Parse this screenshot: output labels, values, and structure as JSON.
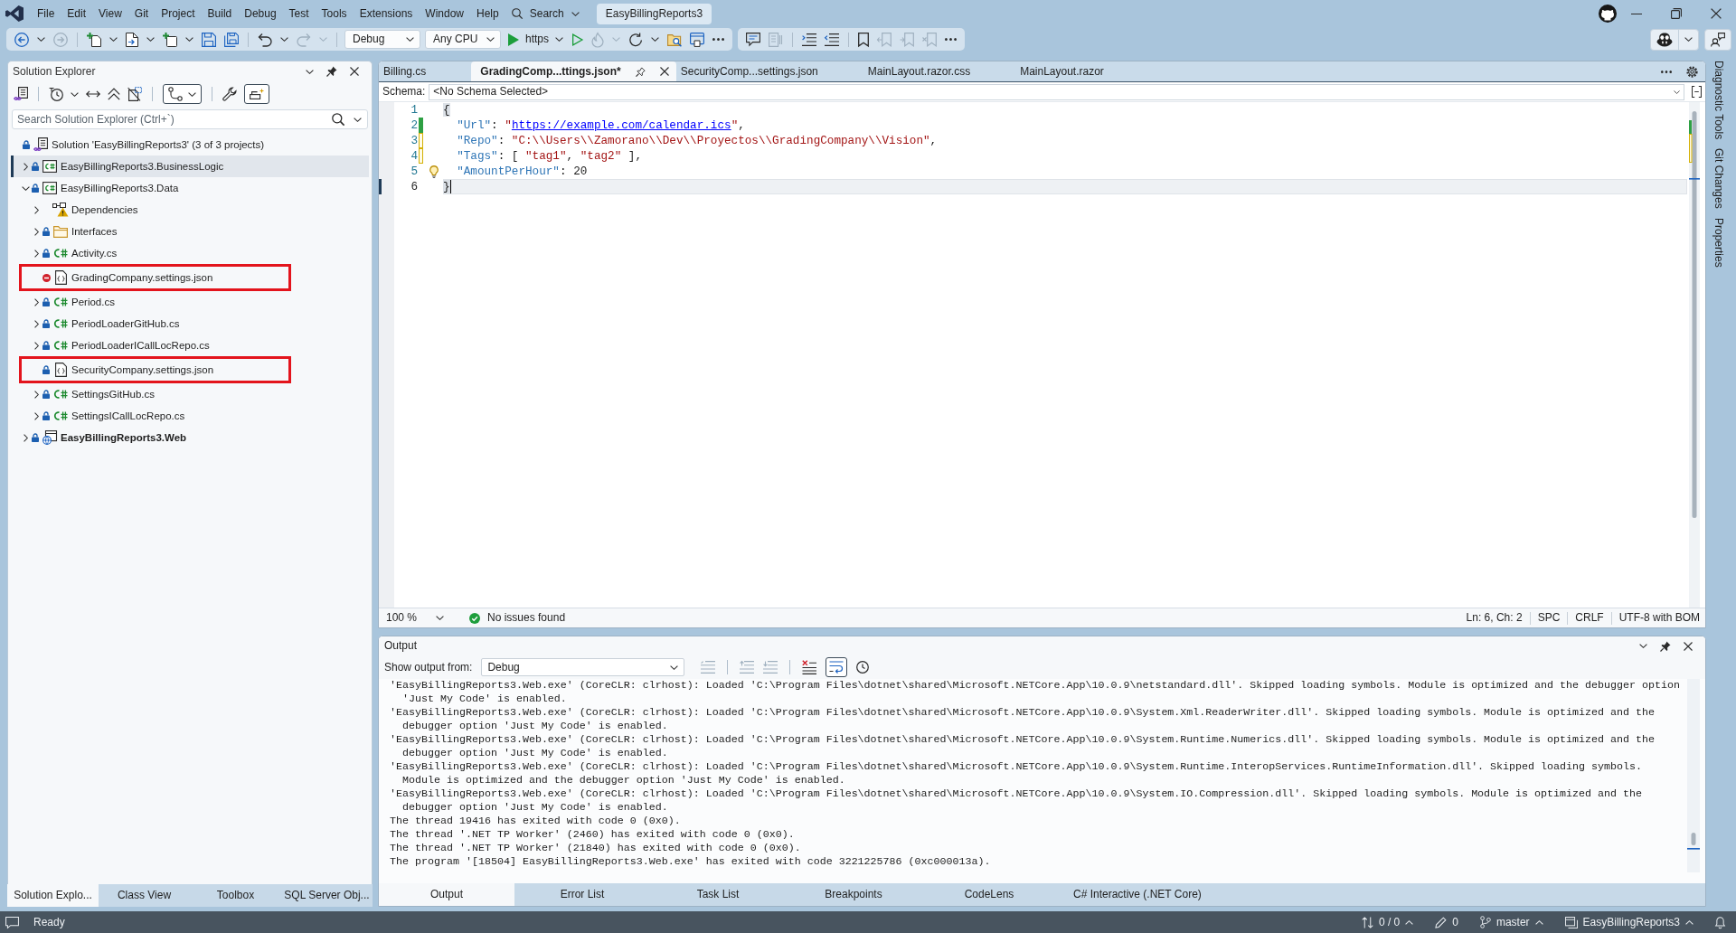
{
  "window": {
    "title": "EasyBillingReports3"
  },
  "menu": [
    "File",
    "Edit",
    "View",
    "Git",
    "Project",
    "Build",
    "Debug",
    "Test",
    "Tools",
    "Extensions",
    "Window",
    "Help"
  ],
  "search": {
    "label": "Search"
  },
  "toolbar": {
    "configuration": "Debug",
    "platform": "Any CPU",
    "launch_profile": "https"
  },
  "solution_explorer": {
    "title": "Solution Explorer",
    "search": {
      "placeholder": "Search Solution Explorer (Ctrl+`)"
    },
    "tree": [
      {
        "label": "Solution 'EasyBillingReports3' (3 of 3 projects)",
        "kind": "solution",
        "locked": true,
        "ignored": false,
        "selected": false,
        "highlighted": false,
        "children": [
          {
            "label": "EasyBillingReports3.BusinessLogic",
            "kind": "csproj",
            "locked": true,
            "ignored": false,
            "expanded": false,
            "startup": false,
            "selected": true,
            "highlighted": false
          },
          {
            "label": "EasyBillingReports3.Data",
            "kind": "csproj",
            "locked": true,
            "ignored": false,
            "expanded": true,
            "startup": false,
            "selected": false,
            "highlighted": false,
            "children": [
              {
                "label": "Dependencies",
                "kind": "dependencies",
                "locked": false,
                "ignored": false,
                "expanded": false,
                "selected": false,
                "highlighted": false
              },
              {
                "label": "Interfaces",
                "kind": "folder",
                "locked": true,
                "ignored": false,
                "expanded": false,
                "selected": false,
                "highlighted": false
              },
              {
                "label": "Activity.cs",
                "kind": "cs",
                "locked": true,
                "ignored": false,
                "expanded": false,
                "selected": false,
                "highlighted": false
              },
              {
                "label": "GradingCompany.settings.json",
                "kind": "json",
                "locked": false,
                "ignored": true,
                "selected": false,
                "highlighted": true
              },
              {
                "label": "Period.cs",
                "kind": "cs",
                "locked": true,
                "ignored": false,
                "expanded": false,
                "selected": false,
                "highlighted": false
              },
              {
                "label": "PeriodLoaderGitHub.cs",
                "kind": "cs",
                "locked": true,
                "ignored": false,
                "expanded": false,
                "selected": false,
                "highlighted": false
              },
              {
                "label": "PeriodLoaderICallLocRepo.cs",
                "kind": "cs",
                "locked": true,
                "ignored": false,
                "expanded": false,
                "selected": false,
                "highlighted": false
              },
              {
                "label": "SecurityCompany.settings.json",
                "kind": "json",
                "locked": true,
                "ignored": false,
                "selected": false,
                "highlighted": true
              },
              {
                "label": "SettingsGitHub.cs",
                "kind": "cs",
                "locked": true,
                "ignored": false,
                "expanded": false,
                "selected": false,
                "highlighted": false
              },
              {
                "label": "SettingsICallLocRepo.cs",
                "kind": "cs",
                "locked": true,
                "ignored": false,
                "expanded": false,
                "selected": false,
                "highlighted": false
              }
            ]
          },
          {
            "label": "EasyBillingReports3.Web",
            "kind": "webproj",
            "locked": true,
            "ignored": false,
            "expanded": false,
            "startup": true,
            "selected": false,
            "highlighted": false
          }
        ]
      }
    ],
    "tabs": [
      {
        "label": "Solution Explo...",
        "selected": true
      },
      {
        "label": "Class View",
        "selected": false
      },
      {
        "label": "Toolbox",
        "selected": false
      },
      {
        "label": "SQL Server Obj...",
        "selected": false
      }
    ]
  },
  "editor": {
    "tabs": [
      {
        "label": "Billing.cs",
        "selected": false
      },
      {
        "label": "GradingComp...ttings.json*",
        "selected": true
      },
      {
        "label": "SecurityComp...settings.json",
        "selected": false
      },
      {
        "label": "MainLayout.razor.css",
        "selected": false
      },
      {
        "label": "MainLayout.razor",
        "selected": false
      }
    ],
    "schema": {
      "label": "Schema:",
      "value": "<No Schema Selected>"
    },
    "lines": [
      {
        "number": "1",
        "saved_change": false,
        "unsaved_change": false,
        "current": false,
        "lightbulb": false,
        "tokens": [
          {
            "kind": "brace",
            "text": "{",
            "matched": true
          }
        ]
      },
      {
        "number": "2",
        "saved_change": true,
        "unsaved_change": false,
        "current": false,
        "lightbulb": false,
        "tokens": [
          {
            "kind": "key",
            "text": "  \"Url\""
          },
          {
            "kind": "punct",
            "text": ": "
          },
          {
            "kind": "string",
            "text": "\""
          },
          {
            "kind": "link",
            "text": "https://example.com/calendar.ics"
          },
          {
            "kind": "string",
            "text": "\""
          },
          {
            "kind": "punct",
            "text": ","
          }
        ]
      },
      {
        "number": "3",
        "saved_change": false,
        "unsaved_change": true,
        "current": false,
        "lightbulb": false,
        "tokens": [
          {
            "kind": "key",
            "text": "  \"Repo\""
          },
          {
            "kind": "punct",
            "text": ": "
          },
          {
            "kind": "string",
            "text": "\"C:\\\\Users\\\\Zamorano\\\\Dev\\\\Proyectos\\\\GradingCompany\\\\Vision\""
          },
          {
            "kind": "punct",
            "text": ","
          }
        ]
      },
      {
        "number": "4",
        "saved_change": false,
        "unsaved_change": true,
        "current": false,
        "lightbulb": false,
        "tokens": [
          {
            "kind": "key",
            "text": "  \"Tags\""
          },
          {
            "kind": "punct",
            "text": ": [ "
          },
          {
            "kind": "string",
            "text": "\"tag1\""
          },
          {
            "kind": "punct",
            "text": ", "
          },
          {
            "kind": "string",
            "text": "\"tag2\""
          },
          {
            "kind": "punct",
            "text": " ],"
          }
        ]
      },
      {
        "number": "5",
        "saved_change": false,
        "unsaved_change": false,
        "current": false,
        "lightbulb": true,
        "tokens": [
          {
            "kind": "key",
            "text": "  \"AmountPerHour\""
          },
          {
            "kind": "punct",
            "text": ": "
          },
          {
            "kind": "number",
            "text": "20"
          }
        ]
      },
      {
        "number": "6",
        "saved_change": false,
        "unsaved_change": false,
        "current": true,
        "lightbulb": false,
        "tokens": [
          {
            "kind": "brace",
            "text": "}",
            "matched": true
          }
        ]
      }
    ],
    "zoom": "100 %",
    "issues": "No issues found",
    "position": "Ln: 6, Ch: 2",
    "indentation": "SPC",
    "line_endings": "CRLF",
    "encoding": "UTF-8 with BOM"
  },
  "output": {
    "title": "Output",
    "source_label": "Show output from:",
    "source": "Debug",
    "word_wrap": true,
    "lines": [
      "'EasyBillingReports3.Web.exe' (CoreCLR: clrhost): Loaded 'C:\\Program Files\\dotnet\\shared\\Microsoft.NETCore.App\\10.0.9\\netstandard.dll'. Skipped loading symbols. Module is optimized and the debugger option 'Just My Code' is enabled.",
      "'EasyBillingReports3.Web.exe' (CoreCLR: clrhost): Loaded 'C:\\Program Files\\dotnet\\shared\\Microsoft.NETCore.App\\10.0.9\\System.Xml.ReaderWriter.dll'. Skipped loading symbols. Module is optimized and the debugger option 'Just My Code' is enabled.",
      "'EasyBillingReports3.Web.exe' (CoreCLR: clrhost): Loaded 'C:\\Program Files\\dotnet\\shared\\Microsoft.NETCore.App\\10.0.9\\System.Runtime.Numerics.dll'. Skipped loading symbols. Module is optimized and the debugger option 'Just My Code' is enabled.",
      "'EasyBillingReports3.Web.exe' (CoreCLR: clrhost): Loaded 'C:\\Program Files\\dotnet\\shared\\Microsoft.NETCore.App\\10.0.9\\System.Runtime.InteropServices.RuntimeInformation.dll'. Skipped loading symbols. Module is optimized and the debugger option 'Just My Code' is enabled.",
      "'EasyBillingReports3.Web.exe' (CoreCLR: clrhost): Loaded 'C:\\Program Files\\dotnet\\shared\\Microsoft.NETCore.App\\10.0.9\\System.IO.Compression.dll'. Skipped loading symbols. Module is optimized and the debugger option 'Just My Code' is enabled.",
      "The thread 19416 has exited with code 0 (0x0).",
      "The thread '.NET TP Worker' (2460) has exited with code 0 (0x0).",
      "The thread '.NET TP Worker' (21840) has exited with code 0 (0x0).",
      "The program '[18504] EasyBillingReports3.Web.exe' has exited with code 3221225786 (0xc000013a)."
    ],
    "tabs": [
      {
        "label": "Output",
        "selected": true
      },
      {
        "label": "Error List",
        "selected": false
      },
      {
        "label": "Task List",
        "selected": false
      },
      {
        "label": "Breakpoints",
        "selected": false
      },
      {
        "label": "CodeLens",
        "selected": false
      },
      {
        "label": "C# Interactive (.NET Core)",
        "selected": false
      }
    ]
  },
  "side_tabs": [
    "Diagnostic Tools",
    "Git Changes",
    "Properties"
  ],
  "status_bar": {
    "message": "Ready",
    "sync": "0 / 0",
    "pending_changes": "0",
    "branch": "master",
    "repository": "EasyBillingReports3"
  }
}
